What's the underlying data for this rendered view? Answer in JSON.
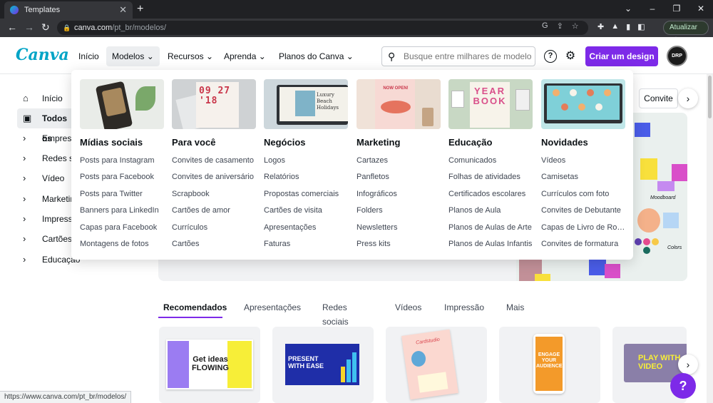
{
  "browser": {
    "tab_title": "Templates",
    "close": "✕",
    "new_tab": "+",
    "window_controls": [
      "⌄",
      "–",
      "❐",
      "✕"
    ],
    "url_host": "canva.com",
    "url_path": "/pt_br/modelos/",
    "update_label": "Atualizar",
    "status_url": "https://www.canva.com/pt_br/modelos/"
  },
  "header": {
    "logo": "Canva",
    "nav": [
      {
        "label": "Início"
      },
      {
        "label": "Modelos ⌄"
      },
      {
        "label": "Recursos ⌄"
      },
      {
        "label": "Aprenda ⌄"
      },
      {
        "label": "Planos do Canva ⌄"
      }
    ],
    "search_placeholder": "Busque entre milhares de modelos",
    "help": "?",
    "create_label": "Criar um design",
    "avatar_text": "DRP"
  },
  "sidebar": {
    "items": [
      {
        "label": "Início",
        "icon": "home-icon"
      },
      {
        "label": "Todos os",
        "icon": "grid-icon"
      },
      {
        "label": "Empresa",
        "icon": "chevron-right-icon"
      },
      {
        "label": "Redes so",
        "icon": "chevron-right-icon"
      },
      {
        "label": "Vídeo",
        "icon": "chevron-right-icon"
      },
      {
        "label": "Marketin",
        "icon": "chevron-right-icon"
      },
      {
        "label": "Impresso",
        "icon": "chevron-right-icon"
      },
      {
        "label": "Cartões",
        "icon": "chevron-right-icon"
      },
      {
        "label": "Educação",
        "icon": "chevron-right-icon"
      }
    ]
  },
  "mega_menu": {
    "columns": [
      {
        "title": "Mídias sociais",
        "links": [
          "Posts para Instagram",
          "Posts para Facebook",
          "Posts para Twitter",
          "Banners para LinkedIn",
          "Capas para Facebook",
          "Montagens de fotos"
        ]
      },
      {
        "title": "Para você",
        "thumb_text": "09 27 '18",
        "links": [
          "Convites de casamento",
          "Convites de aniversário",
          "Scrapbook",
          "Cartões de amor",
          "Currículos",
          "Cartões"
        ]
      },
      {
        "title": "Negócios",
        "thumb_text": "Luxury Beach Holidays",
        "links": [
          "Logos",
          "Relatórios",
          "Propostas comerciais",
          "Cartões de visita",
          "Apresentações",
          "Faturas"
        ]
      },
      {
        "title": "Marketing",
        "thumb_text": "NOW OPEN!",
        "links": [
          "Cartazes",
          "Panfletos",
          "Infográficos",
          "Folders",
          "Newsletters",
          "Press kits"
        ]
      },
      {
        "title": "Educação",
        "thumb_text": "YEAR BOOK",
        "links": [
          "Comunicados",
          "Folhas de atividades",
          "Certificados escolares",
          "Planos de Aula",
          "Planos de Aulas de Arte",
          "Planos de Aulas Infantis"
        ]
      },
      {
        "title": "Novidades",
        "links": [
          "Vídeos",
          "Camisetas",
          "Currículos com foto",
          "Convites de Debutante",
          "Capas de Livro de Romance",
          "Convites de formatura"
        ]
      }
    ]
  },
  "hero": {
    "chip": "Convite",
    "moodboard": "Moodboard",
    "colors": "Colors"
  },
  "content_tabs": [
    "Recomendados",
    "Apresentações",
    "Redes sociais",
    "Vídeos",
    "Impressão",
    "Mais"
  ],
  "cards": [
    {
      "text": "Get ideas FLOWING"
    },
    {
      "text": "PRESENT WITH EASE"
    },
    {
      "text": "Cardstudio"
    },
    {
      "text": "ENGAGE YOUR AUDIENCE"
    },
    {
      "text": "PLAY WITH VIDEO"
    }
  ],
  "arrow": "›",
  "help_fab": "?"
}
